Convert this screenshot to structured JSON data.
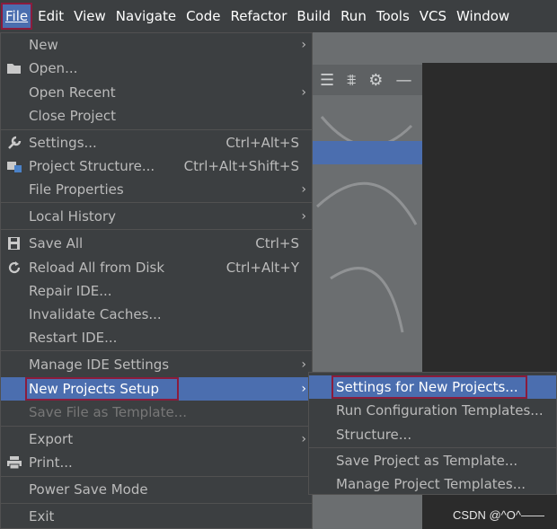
{
  "menubar": {
    "items": [
      "File",
      "Edit",
      "View",
      "Navigate",
      "Code",
      "Refactor",
      "Build",
      "Run",
      "Tools",
      "VCS",
      "Window"
    ]
  },
  "file_menu": {
    "new": "New",
    "open": "Open...",
    "open_recent": "Open Recent",
    "close_project": "Close Project",
    "settings": "Settings...",
    "settings_sc": "Ctrl+Alt+S",
    "project_structure": "Project Structure...",
    "project_structure_sc": "Ctrl+Alt+Shift+S",
    "file_properties": "File Properties",
    "local_history": "Local History",
    "save_all": "Save All",
    "save_all_sc": "Ctrl+S",
    "reload": "Reload All from Disk",
    "reload_sc": "Ctrl+Alt+Y",
    "repair": "Repair IDE...",
    "invalidate": "Invalidate Caches...",
    "restart": "Restart IDE...",
    "manage_ide": "Manage IDE Settings",
    "new_projects_setup": "New Projects Setup",
    "save_template": "Save File as Template...",
    "export": "Export",
    "print": "Print...",
    "power_save": "Power Save Mode",
    "exit": "Exit"
  },
  "sub_menu": {
    "settings_new": "Settings for New Projects...",
    "run_config": "Run Configuration Templates...",
    "structure": "Structure...",
    "save_project_template": "Save Project as Template...",
    "manage_templates": "Manage Project Templates..."
  },
  "watermark": "CSDN @^O^——"
}
